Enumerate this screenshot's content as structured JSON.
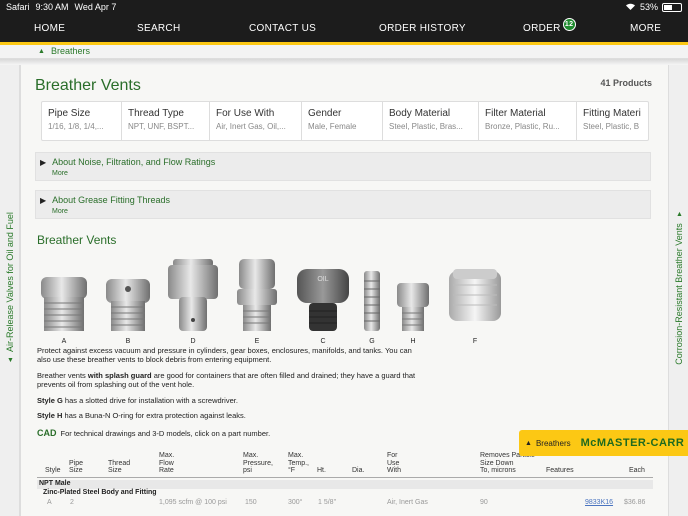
{
  "statusbar": {
    "carrier": "Safari",
    "time": "9:30 AM",
    "date": "Wed Apr 7",
    "battery": "53%",
    "battery_level": 0.53
  },
  "nav": {
    "home": "HOME",
    "search": "SEARCH",
    "contact": "CONTACT US",
    "history": "ORDER HISTORY",
    "order": "ORDER",
    "order_count": "12",
    "more": "MORE"
  },
  "breadcrumb": {
    "label": "Breathers"
  },
  "left_rail": {
    "label": "Air-Release Valves for Oil and Fuel"
  },
  "right_rail": {
    "label": "Corrosion-Resistant Breather Vents"
  },
  "page": {
    "title": "Breather Vents",
    "count": "41 Products"
  },
  "filters": [
    {
      "name": "Pipe Size",
      "values": "1/16, 1/8, 1/4,..."
    },
    {
      "name": "Thread Type",
      "values": "NPT, UNF, BSPT..."
    },
    {
      "name": "For Use With",
      "values": "Air, Inert Gas, Oil,..."
    },
    {
      "name": "Gender",
      "values": "Male, Female"
    },
    {
      "name": "Body Material",
      "values": "Steel, Plastic, Bras..."
    },
    {
      "name": "Filter Material",
      "values": "Bronze, Plastic, Ru..."
    },
    {
      "name": "Fitting Materi",
      "values": "Steel, Plastic, B"
    }
  ],
  "accordions": [
    {
      "title": "About Noise, Filtration, and Flow Ratings",
      "more": "More"
    },
    {
      "title": "About Grease Fitting Threads",
      "more": "More"
    }
  ],
  "section": {
    "title": "Breather Vents"
  },
  "product_labels": [
    "A",
    "B",
    "D",
    "E",
    "C",
    "G",
    "H",
    "F"
  ],
  "description": {
    "p1": "Protect against excess vacuum and pressure in cylinders, gear boxes, enclosures, manifolds, and tanks. You can also use these breather vents to block debris from entering equipment.",
    "p2a": "Breather vents ",
    "p2b": "with splash guard",
    "p2c": " are good for containers that are often filled and drained; they have a guard that prevents oil from splashing out of the vent hole.",
    "p3a": "Style G",
    "p3b": " has a slotted drive for installation with a screwdriver.",
    "p4a": "Style H",
    "p4b": " has a Buna-N O-ring for extra protection against leaks.",
    "cad_icon": "CAD",
    "cad": "For technical drawings and 3-D models, click on a part number."
  },
  "table": {
    "headers": [
      "Style",
      "Pipe\nSize",
      "Thread\nSize",
      "Max.\nFlow\nRate",
      "Max.\nPressure,\npsi",
      "Max.\nTemp.,\n°F",
      "Ht.",
      "Dia.",
      "For\nUse\nWith",
      "Removes Particle\nSize Down\nTo, microns",
      "Features",
      "Each"
    ],
    "group": "NPT Male",
    "subgroup": "Zinc-Plated Steel Body and Fitting",
    "row": {
      "style": "A",
      "pipe": "2",
      "flow": "1,095 scfm @ 100 psi",
      "pressure": "150",
      "temp": "300°",
      "ht": "1 5/8\"",
      "use": "Air, Inert Gas",
      "microns": "90",
      "part": "9833K16",
      "each": "$36.86"
    }
  },
  "promo": {
    "label": "Breathers",
    "logo": "McMASTER-CARR"
  }
}
